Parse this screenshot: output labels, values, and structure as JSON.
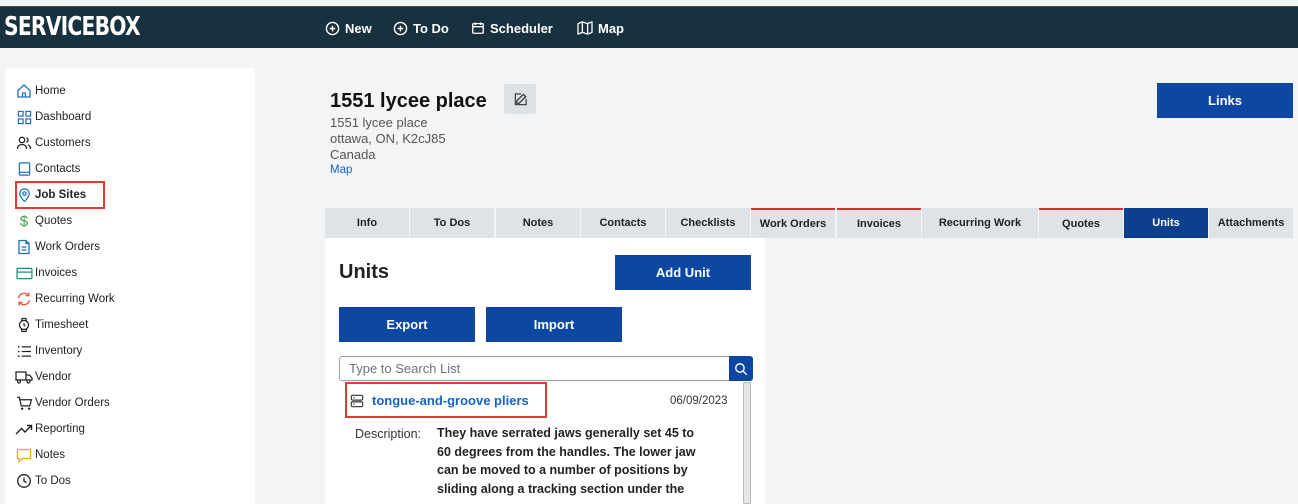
{
  "app": {
    "logo": "SERVICEBOX"
  },
  "topnav": [
    {
      "label": "New",
      "icon": "plus-circle-icon"
    },
    {
      "label": "To Do",
      "icon": "plus-circle-icon"
    },
    {
      "label": "Scheduler",
      "icon": "calendar-icon"
    },
    {
      "label": "Map",
      "icon": "map-icon"
    }
  ],
  "sidebar": {
    "items": [
      {
        "label": "Home",
        "icon": "home-icon"
      },
      {
        "label": "Dashboard",
        "icon": "grid-icon"
      },
      {
        "label": "Customers",
        "icon": "users-icon"
      },
      {
        "label": "Contacts",
        "icon": "contact-book-icon"
      },
      {
        "label": "Job Sites",
        "icon": "location-pin-icon",
        "active": true
      },
      {
        "label": "Quotes",
        "icon": "dollar-icon"
      },
      {
        "label": "Work Orders",
        "icon": "document-icon"
      },
      {
        "label": "Invoices",
        "icon": "card-icon"
      },
      {
        "label": "Recurring Work",
        "icon": "refresh-icon"
      },
      {
        "label": "Timesheet",
        "icon": "watch-icon"
      },
      {
        "label": "Inventory",
        "icon": "list-icon"
      },
      {
        "label": "Vendor",
        "icon": "truck-icon"
      },
      {
        "label": "Vendor Orders",
        "icon": "cart-icon"
      },
      {
        "label": "Reporting",
        "icon": "trend-up-icon"
      },
      {
        "label": "Notes",
        "icon": "chat-icon"
      },
      {
        "label": "To Dos",
        "icon": "clock-icon"
      }
    ]
  },
  "site": {
    "title": "1551 lycee place",
    "address_line1": "1551 lycee place",
    "address_line2": "ottawa, ON, K2cJ85",
    "address_line3": "Canada",
    "map_link": "Map"
  },
  "links_button": "Links",
  "tabs": [
    {
      "label": "Info"
    },
    {
      "label": "To Dos"
    },
    {
      "label": "Notes"
    },
    {
      "label": "Contacts"
    },
    {
      "label": "Checklists"
    },
    {
      "label": "Work Orders"
    },
    {
      "label": "Invoices"
    },
    {
      "label": "Recurring Work"
    },
    {
      "label": "Quotes"
    },
    {
      "label": "Units",
      "active": true
    },
    {
      "label": "Attachments"
    }
  ],
  "units": {
    "title": "Units",
    "add_button": "Add Unit",
    "export_button": "Export",
    "import_button": "Import",
    "search_placeholder": "Type to Search List",
    "list": [
      {
        "name": "tongue-and-groove pliers",
        "date": "06/09/2023",
        "description_label": "Description:",
        "description_lines": [
          "They have serrated jaws generally set 45 to",
          "60 degrees from the handles. The lower jaw",
          "can be moved to a number of positions by",
          "sliding along a tracking section under the"
        ]
      }
    ]
  },
  "colors": {
    "topbar": "#17313f",
    "primary": "#0d47a1",
    "highlight": "#e53935",
    "link": "#1565c0",
    "tab_marker": "#d32f2f"
  }
}
